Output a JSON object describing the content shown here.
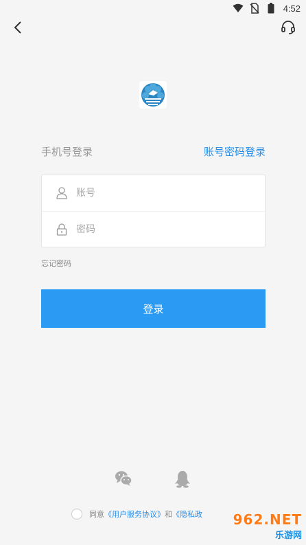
{
  "status_bar": {
    "time": "4:52",
    "icons": [
      "wifi-icon",
      "no-sim-icon",
      "battery-icon"
    ]
  },
  "header": {
    "back_icon": "chevron-left-icon",
    "service_icon": "headset-icon"
  },
  "login_mode": {
    "phone_label": "手机号登录",
    "account_label": "账号密码登录"
  },
  "form": {
    "account_placeholder": "账号",
    "password_placeholder": "密码",
    "account_icon": "user-icon",
    "password_icon": "lock-icon"
  },
  "forgot_password": "忘记密码",
  "login_button": "登录",
  "social": {
    "wechat_icon": "wechat-icon",
    "qq_icon": "qq-icon"
  },
  "agreement": {
    "prefix": "同意",
    "user_agreement": "《用户服务协议》",
    "and": "和",
    "privacy_policy": "《隐私政"
  },
  "watermark": {
    "top": "962.NET",
    "bottom": "乐游网"
  },
  "colors": {
    "accent": "#2b9af3",
    "link": "#2b8fe8",
    "background": "#f5f5f5"
  }
}
